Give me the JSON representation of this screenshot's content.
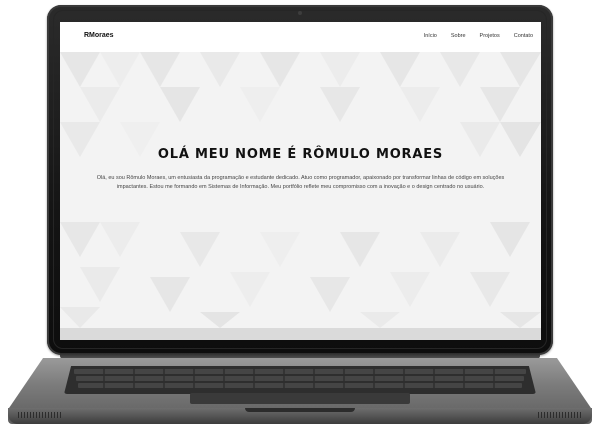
{
  "site": {
    "brand": "RMoraes",
    "nav": [
      {
        "label": "Início"
      },
      {
        "label": "Sobre"
      },
      {
        "label": "Projetos"
      },
      {
        "label": "Contato"
      }
    ]
  },
  "hero": {
    "title": "OLÁ MEU NOME É RÔMULO MORAES",
    "description": "Olá, eu sou Rômulo Moraes, um entusiasta da programação e estudante dedicado. Atuo como programador, apaixonado por transformar linhas de código em soluções impactantes. Estou me formando em Sistemas de Informação. Meu portfólio reflete meu compromisso com a inovação e o design centrado no usuário."
  },
  "colors": {
    "screen_bg": "#f3f3f3",
    "text_dark": "#111111",
    "laptop_body": "#7c7c7c",
    "bezel": "#141414"
  }
}
